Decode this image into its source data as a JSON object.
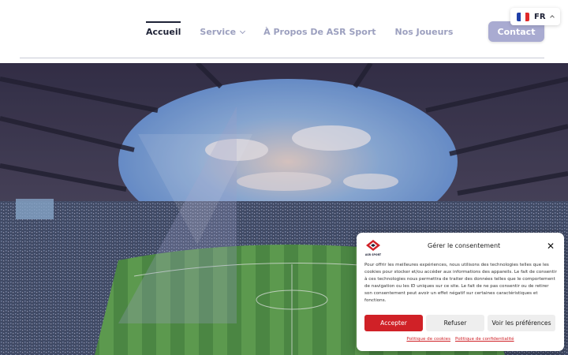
{
  "nav": {
    "items": [
      {
        "label": "Accueil"
      },
      {
        "label": "Service"
      },
      {
        "label": "À Propos De ASR Sport"
      },
      {
        "label": "Nos Joueurs"
      }
    ],
    "contact_label": "Contact"
  },
  "language": {
    "code": "FR",
    "flag_colors": [
      "#1f3fa8",
      "#ffffff",
      "#e02a2a"
    ]
  },
  "colors": {
    "nav_active": "#1e2236",
    "nav_inactive": "#9ca0bf",
    "contact_bg": "#a9abd1",
    "consent_accent": "#d02127"
  },
  "consent": {
    "title": "Gérer le consentement",
    "body": "Pour offrir les meilleures expériences, nous utilisons des technologies telles que les cookies pour stocker et/ou accéder aux informations des appareils. Le fait de consentir à ces technologies nous permettra de traiter des données telles que le comportement de navigation ou les ID uniques sur ce site. Le fait de ne pas consentir ou de retirer son consentement peut avoir un effet négatif sur certaines caractéristiques et fonctions.",
    "accept_label": "Accepter",
    "refuse_label": "Refuser",
    "prefs_label": "Voir les préférences",
    "cookie_policy_label": "Politique de cookies",
    "privacy_policy_label": "Politique de confidentialité",
    "logo_text": "ASR SPORT"
  }
}
